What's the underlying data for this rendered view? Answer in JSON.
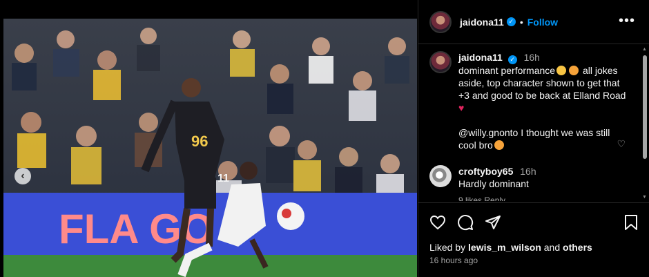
{
  "post": {
    "username": "jaidona11",
    "follow_label": "Follow",
    "more_icon": "more-icon"
  },
  "caption": {
    "username": "jaidona11",
    "time": "16h",
    "line1": "dominant performance",
    "line1b": "all jokes aside, top character shown to get that +3 and good to be back at Elland Road",
    "line2": "@willy.gnonto I thought we was still cool bro"
  },
  "comment": {
    "username": "croftyboy65",
    "time": "16h",
    "text": "Hardly dominant",
    "likes_partial": "9 likes   Reply"
  },
  "image_banner_text": "FLA      GO",
  "image_shirt_text": "96",
  "image_player_number": "11",
  "liked_by": {
    "prefix": "Liked by",
    "user": "lewis_m_wilson",
    "and": "and",
    "others": "others"
  },
  "timestamp": "16 hours ago",
  "colors": {
    "accent": "#0095f6",
    "background": "#000000",
    "secondary_text": "#a8a8a8"
  }
}
